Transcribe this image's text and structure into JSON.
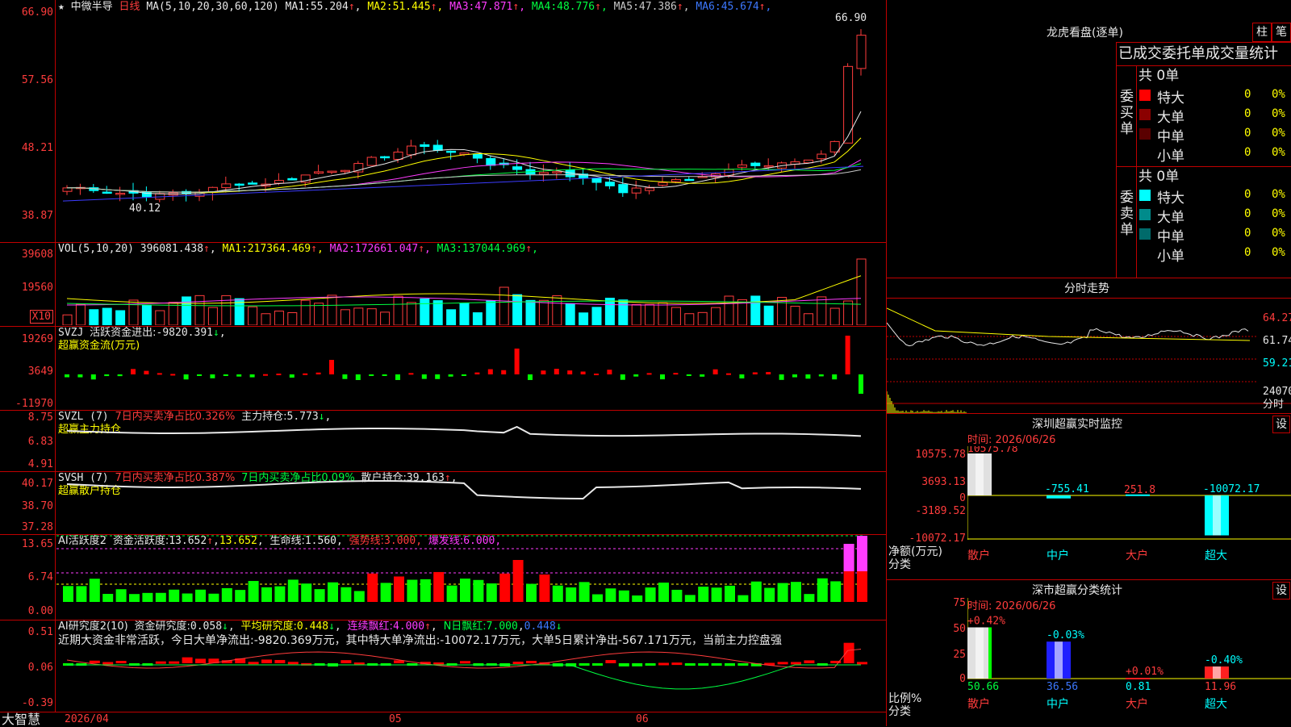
{
  "stock": {
    "star": "★",
    "name": "中微半导",
    "period": "日线"
  },
  "ma_panel": {
    "label": "MA(5,10,20,30,60,120)",
    "items": [
      {
        "name": "MA1:",
        "value": "55.204",
        "arrow": "↑",
        "color": "#e8e8e8"
      },
      {
        "name": "MA2:",
        "value": "51.445",
        "arrow": "↑",
        "color": "#ffff00"
      },
      {
        "name": "MA3:",
        "value": "47.871",
        "arrow": "↑",
        "color": "#ff3cff"
      },
      {
        "name": "MA4:",
        "value": "48.776",
        "arrow": "↑",
        "color": "#00ff40"
      },
      {
        "name": "MA5:",
        "value": "47.386",
        "arrow": "↑",
        "color": "#c8c8c8"
      },
      {
        "name": "MA6:",
        "value": "45.674",
        "arrow": "↑",
        "color": "#3c78ff"
      }
    ],
    "yticks": [
      "66.90",
      "57.56",
      "48.21",
      "38.87"
    ],
    "high_label": "66.90",
    "low_label": "40.12"
  },
  "vol_panel": {
    "label": "VOL(5,10,20)",
    "value": "396081.438",
    "arrow": "↑",
    "items": [
      {
        "name": "MA1:",
        "value": "217364.469",
        "arrow": "↑",
        "color": "#ffff00"
      },
      {
        "name": "MA2:",
        "value": "172661.047",
        "arrow": "↑",
        "color": "#ff3cff"
      },
      {
        "name": "MA3:",
        "value": "137044.969",
        "arrow": "↑",
        "color": "#00ff40"
      }
    ],
    "yticks": [
      "39608",
      "19560"
    ],
    "unit": "X10"
  },
  "svzj_panel": {
    "label": "SVZJ",
    "desc": "活跃资金进出:",
    "value": "-9820.391",
    "arrow": "↓",
    "sep": ",",
    "title": "超赢资金流(万元)",
    "yticks": [
      "19269",
      "3649",
      "-11970"
    ]
  },
  "svzl_panel": {
    "label": "SVZL (7)",
    "desc1": "7日内买卖净占比0.326%",
    "desc2": "主力持仓:",
    "value": "5.773",
    "arrow": "↓",
    "sep": ",",
    "title": "超赢主力持仓",
    "yticks": [
      "8.75",
      "6.83",
      "4.91"
    ]
  },
  "svsh_panel": {
    "label": "SVSH (7)",
    "desc1": "7日内买卖净占比0.387%",
    "desc2": "7日内买卖净占比0.09%",
    "desc3": "散户持仓:",
    "value": "39.163",
    "arrow": "↑",
    "sep": ",",
    "title": "超赢散户持仓",
    "yticks": [
      "40.17",
      "38.70",
      "37.28"
    ]
  },
  "ai_act_panel": {
    "label": "AI活跃度2",
    "d1": "资金活跃度:",
    "v1": "13.652",
    "a1": "↑",
    "v2": "13.652",
    "d3": "生命线:",
    "v3": "1.560",
    "d4": "强势线:",
    "v4": "3.000",
    "d5": "爆发线:",
    "v5": "6.000",
    "yticks": [
      "13.65",
      "6.74",
      "0.00"
    ]
  },
  "ai_res_panel": {
    "label": "AI研究度2(10)",
    "d1": "资金研究度:",
    "v1": "0.058",
    "a1": "↓",
    "d2": "平均研究度:",
    "v2": "0.448",
    "a2": "↓",
    "d3": "连续飘红:",
    "v3": "4.000",
    "a3": "↑",
    "d4": "N日飘红:",
    "v4": "7.000",
    "v5": "0.448",
    "a5": "↓",
    "summary": "近期大资金非常活跃，今日大单净流出:-9820.369万元，其中特大单净流出:-10072.17万元，大单5日累计净出-567.171万元，当前主力控盘强",
    "yticks": [
      "0.51",
      "0.06",
      "-0.39"
    ]
  },
  "footer": {
    "brand": "大智慧",
    "dates": [
      "2026/04",
      "05",
      "06"
    ]
  },
  "lhb": {
    "title": "龙虎看盘(逐单)",
    "btn1": "柱",
    "btn2": "笔",
    "header": "已成交委托单成交量统计",
    "buy_label": "委买单",
    "buy_total": "共 0单",
    "buy_rows": [
      {
        "name": "特大",
        "count": "0",
        "pct": "0%",
        "color": "#ff0000"
      },
      {
        "name": "大单",
        "count": "0",
        "pct": "0%",
        "color": "#8b0000"
      },
      {
        "name": "中单",
        "count": "0",
        "pct": "0%",
        "color": "#5a0000"
      },
      {
        "name": "小单",
        "count": "0",
        "pct": "0%",
        "color": "#000000"
      }
    ],
    "sell_label": "委卖单",
    "sell_total": "共 0单",
    "sell_rows": [
      {
        "name": "特大",
        "count": "0",
        "pct": "0%",
        "color": "#00ffff"
      },
      {
        "name": "大单",
        "count": "0",
        "pct": "0%",
        "color": "#008b8b"
      },
      {
        "name": "中单",
        "count": "0",
        "pct": "0%",
        "color": "#006a6a"
      },
      {
        "name": "小单",
        "count": "0",
        "pct": "0%",
        "color": "#000000"
      }
    ]
  },
  "intraday": {
    "title": "分时走势",
    "prices": [
      "64.27",
      "61.74",
      "59.21"
    ],
    "volume": "24070",
    "vol_label": "分时"
  },
  "sz_monitor": {
    "title": "深圳超赢实时监控",
    "btn": "设",
    "time_label": "时间: 2026/06/26",
    "yticks": [
      "10575.78",
      "3693.13",
      "0",
      "-3189.52",
      "-10072.17"
    ],
    "bars": [
      {
        "name": "散户",
        "value": "10575.78",
        "v": 10575.78
      },
      {
        "name": "中户",
        "value": "-755.41",
        "v": -755.41
      },
      {
        "name": "大户",
        "value": "251.8",
        "v": 251.8
      },
      {
        "name": "超大",
        "value": "-10072.17",
        "v": -10072.17
      }
    ],
    "ylabel1": "净额(万元)",
    "ylabel2": "分类"
  },
  "sz_classify": {
    "title": "深市超赢分类统计",
    "btn": "设",
    "time_label": "时间: 2026/06/26",
    "yticks": [
      "75",
      "50",
      "25",
      "0"
    ],
    "bars": [
      {
        "name": "散户",
        "value": "50.66",
        "v": 50.66,
        "delta": "+0.42%"
      },
      {
        "name": "中户",
        "value": "36.56",
        "v": 36.56,
        "delta": "-0.03%"
      },
      {
        "name": "大户",
        "value": "0.81",
        "v": 0.81,
        "delta": "+0.01%"
      },
      {
        "name": "超大",
        "value": "11.96",
        "v": 11.96,
        "delta": "-0.40%"
      }
    ],
    "ylabel1": "比例%",
    "ylabel2": "分类"
  },
  "chart_data": {
    "type": "candlestick",
    "title": "中微半导 日线",
    "ylim": [
      38.87,
      66.9
    ],
    "last_close": 66.9
  }
}
